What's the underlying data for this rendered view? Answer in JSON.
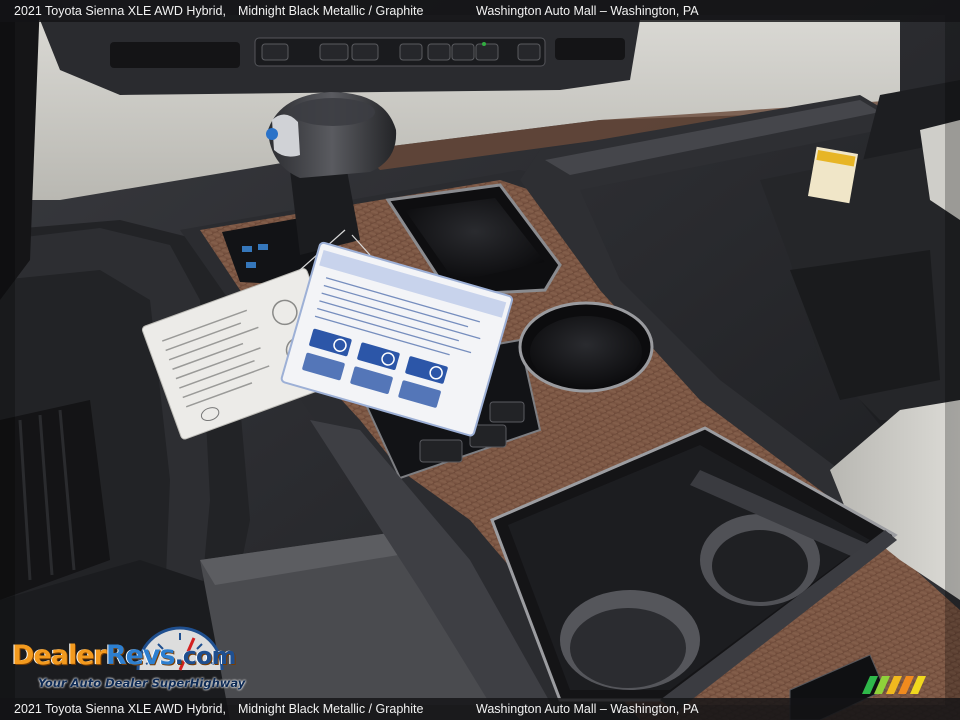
{
  "caption": {
    "vehicle": "2021 Toyota Sienna XLE AWD Hybrid,",
    "color": "Midnight Black Metallic / Graphite",
    "dealer": "Washington Auto Mall – Washington, PA"
  },
  "watermark": {
    "logo_part1": "Dealer",
    "logo_part2": "Revs",
    "logo_part3": ".com",
    "tagline": "Your Auto Dealer SuperHighway"
  },
  "colors": {
    "wood": "#7a5340",
    "console": "#2b2c30",
    "caption_bar": "#141416",
    "logo_orange": "#f39a1e",
    "logo_blue": "#2d7fd0"
  }
}
